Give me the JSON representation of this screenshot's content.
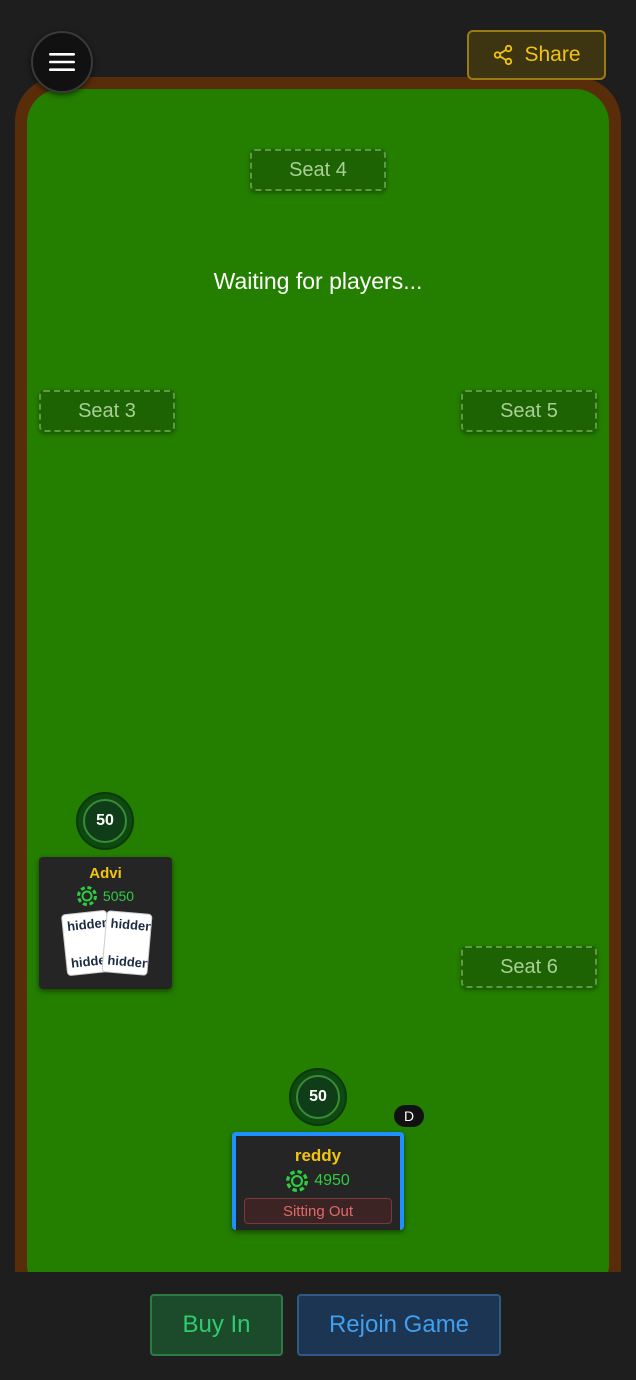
{
  "header": {
    "share_label": "Share",
    "menu_icon": "hamburger-icon",
    "share_icon": "share-icon"
  },
  "table": {
    "status_message": "Waiting for players...",
    "empty_seats": {
      "seat3": "Seat 3",
      "seat4": "Seat 4",
      "seat5": "Seat 5",
      "seat6": "Seat 6"
    },
    "dealer_label": "D"
  },
  "players": {
    "advi": {
      "name": "Advi",
      "stack": "5050",
      "bet": "50",
      "cards": [
        "hidden",
        "hidden"
      ]
    },
    "reddy": {
      "name": "reddy",
      "stack": "4950",
      "bet": "50",
      "status": "Sitting Out"
    }
  },
  "actions": {
    "buy_in": "Buy In",
    "rejoin": "Rejoin Game"
  },
  "colors": {
    "felt": "#247f00",
    "rim": "#5a2d0a",
    "accent_gold": "#f1c40f",
    "stack_green": "#2ecc40",
    "active_player_border": "#1e90ff"
  }
}
